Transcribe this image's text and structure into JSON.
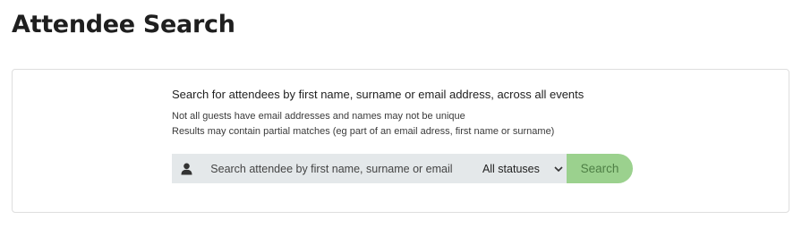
{
  "page": {
    "title": "Attendee Search"
  },
  "search_panel": {
    "intro": "Search for attendees by first name, surname or email address, across all events",
    "notes": [
      "Not all guests have email addresses and names may not be unique",
      "Results may contain partial matches (eg part of an email adress, first name or surname)"
    ],
    "input": {
      "value": "",
      "placeholder": "Search attendee by first name, surname or email",
      "icon": "user-icon"
    },
    "status_select": {
      "selected": "All statuses",
      "icon": "chevron-down-icon"
    },
    "search_button": {
      "label": "Search",
      "color": "#9bd18e",
      "text_color": "#4e7f45"
    }
  }
}
